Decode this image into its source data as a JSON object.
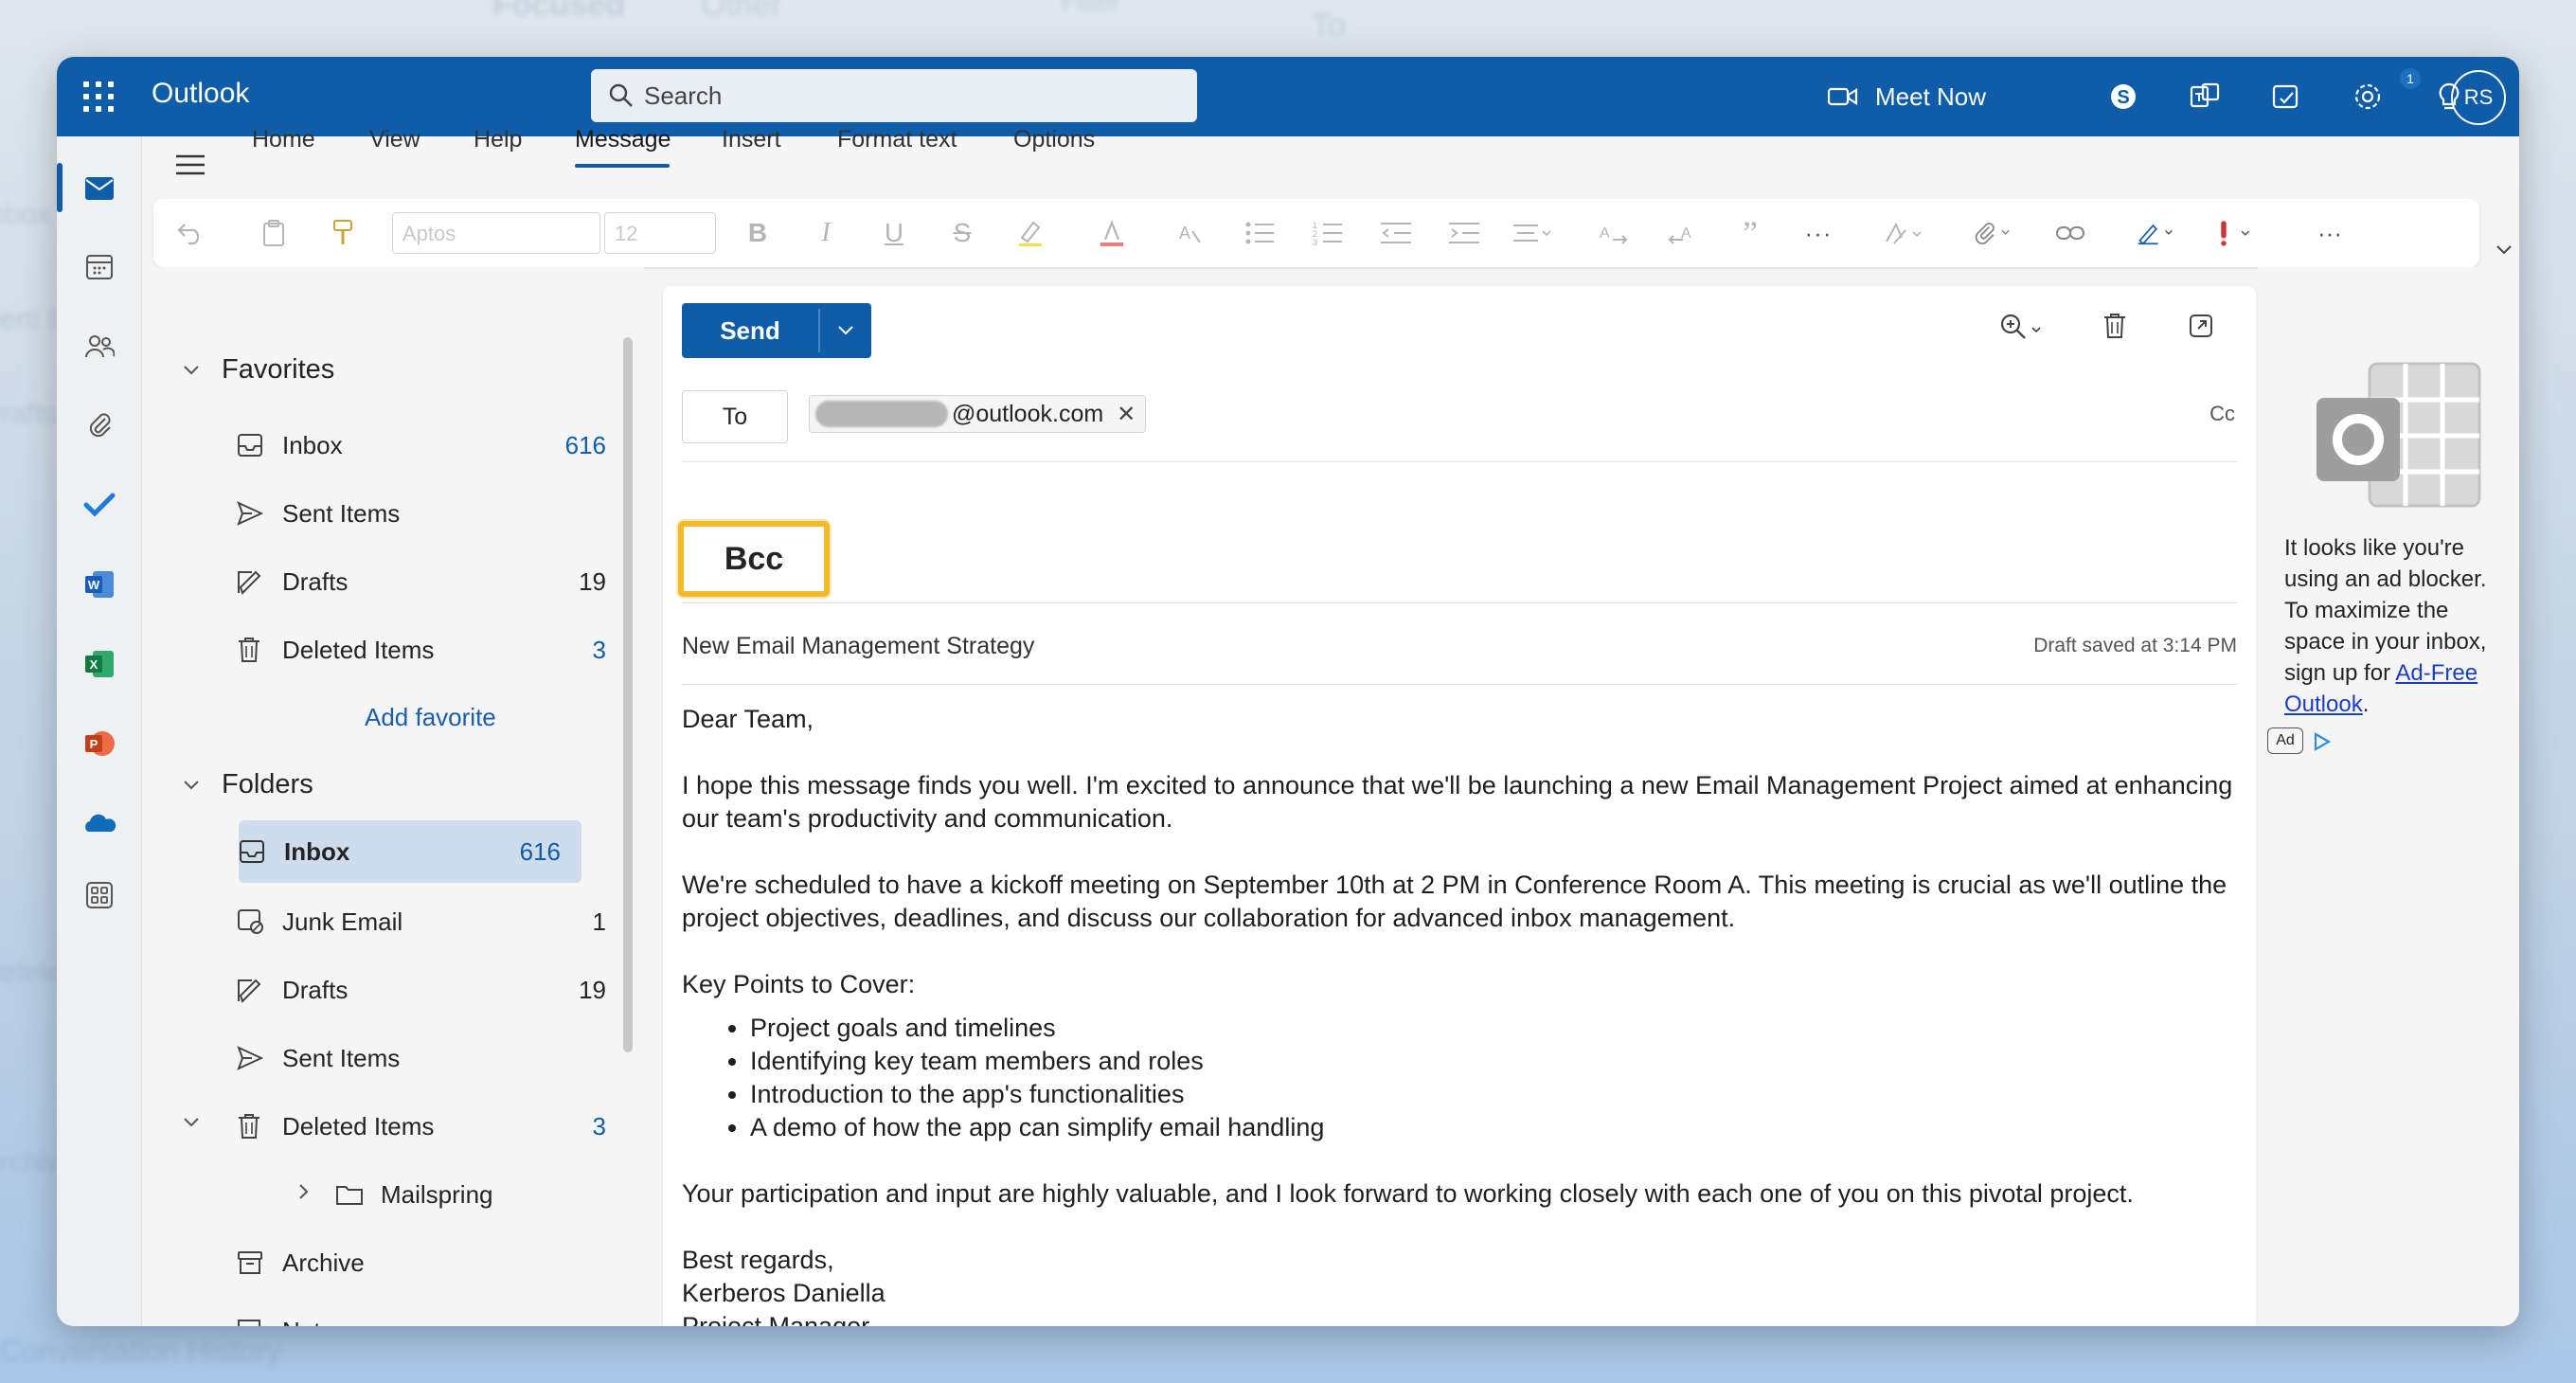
{
  "background": {
    "hints": [
      "Focused",
      "Other",
      "Filter",
      "To",
      "Inbox",
      "Sent Items",
      "Drafts",
      "Deleted",
      "Archive",
      "Conversation History"
    ]
  },
  "topbar": {
    "app_name": "Outlook",
    "search_placeholder": "Search",
    "meet_now_label": "Meet Now",
    "notification_count": "1",
    "avatar_initials": "RS",
    "color": "#0f5ca8"
  },
  "ribbon": {
    "tabs": [
      "Home",
      "View",
      "Help",
      "Message",
      "Insert",
      "Format text",
      "Options"
    ],
    "active_tab": "Message",
    "font_name": "Aptos",
    "font_size": "12"
  },
  "favorites": {
    "header": "Favorites",
    "items": [
      {
        "label": "Inbox",
        "count": "616",
        "icon": "inbox-icon"
      },
      {
        "label": "Sent Items",
        "count": "",
        "icon": "send-icon"
      },
      {
        "label": "Drafts",
        "count": "19",
        "icon": "drafts-icon"
      },
      {
        "label": "Deleted Items",
        "count": "3",
        "icon": "trash-icon"
      }
    ],
    "add_favorite": "Add favorite"
  },
  "folders": {
    "header": "Folders",
    "items": [
      {
        "label": "Inbox",
        "count": "616",
        "icon": "inbox-icon"
      },
      {
        "label": "Junk Email",
        "count": "1",
        "icon": "junk-icon"
      },
      {
        "label": "Drafts",
        "count": "19",
        "icon": "drafts-icon"
      },
      {
        "label": "Sent Items",
        "count": "",
        "icon": "send-icon"
      },
      {
        "label": "Deleted Items",
        "count": "3",
        "icon": "trash-icon"
      },
      {
        "label": "Mailspring",
        "count": "",
        "icon": "folder-icon"
      },
      {
        "label": "Archive",
        "count": "",
        "icon": "archive-icon"
      },
      {
        "label": "Notes",
        "count": "",
        "icon": "notes-icon"
      }
    ],
    "selected": "Inbox"
  },
  "compose": {
    "send_label": "Send",
    "to_label": "To",
    "recipient_domain": "@outlook.com",
    "cc_label": "Cc",
    "bcc_label": "Bcc",
    "highlight_color": "#f6b92b",
    "subject": "New Email Management Strategy",
    "draft_status": "Draft saved at 3:14 PM",
    "greeting": "Dear Team,",
    "para1": "I hope this message finds you well. I'm excited to announce that we'll be launching a new Email Management Project aimed at enhancing our team's productivity and communication.",
    "para2": "We're scheduled to have a kickoff meeting on September 10th at 2 PM in Conference Room A. This meeting is crucial as we'll outline the project objectives, deadlines, and discuss our collaboration for advanced inbox management.",
    "key_points_heading": "Key Points to Cover:",
    "key_points": [
      "Project goals and timelines",
      "Identifying key team members and roles",
      "Introduction to the app's functionalities",
      "A demo of how the app can simplify email handling"
    ],
    "para3": "Your participation and input are highly valuable, and I look forward to working closely with each one of you on this pivotal project.",
    "closing": "Best regards,",
    "sender_name": "Kerberos Daniella",
    "sender_title": "Project Manager"
  },
  "ad": {
    "text_before_link": "It looks like you're using an ad blocker. To maximize the space in your inbox, sign up for ",
    "link_text": "Ad-Free Outlook",
    "text_after_link": ".",
    "badge": "Ad"
  }
}
